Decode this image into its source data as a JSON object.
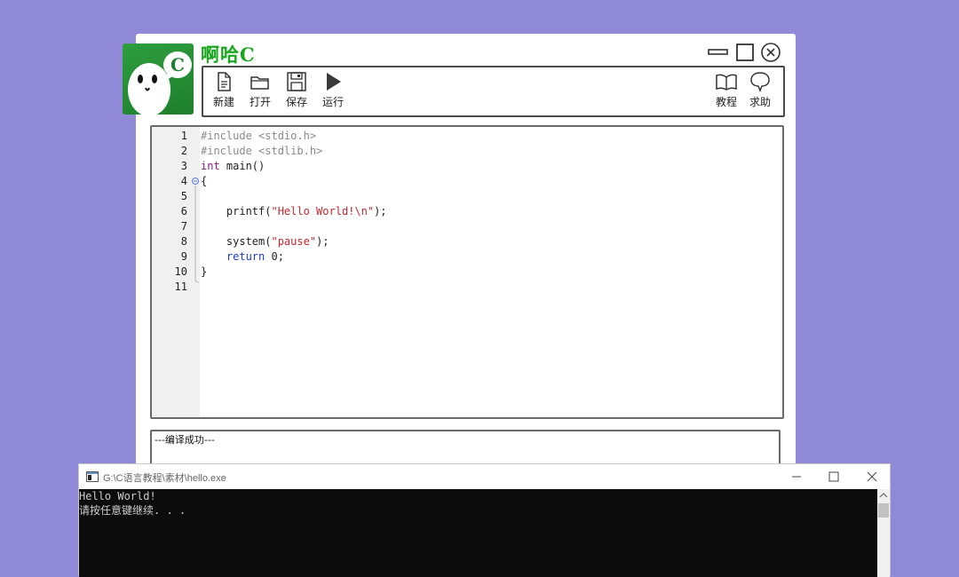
{
  "app": {
    "title": "啊哈C"
  },
  "toolbar": {
    "left": [
      {
        "label": "新建",
        "icon": "new-file-icon"
      },
      {
        "label": "打开",
        "icon": "open-folder-icon"
      },
      {
        "label": "保存",
        "icon": "save-disk-icon"
      },
      {
        "label": "运行",
        "icon": "run-play-icon"
      }
    ],
    "right": [
      {
        "label": "教程",
        "icon": "book-icon"
      },
      {
        "label": "求助",
        "icon": "speech-bubble-icon"
      }
    ]
  },
  "editor": {
    "lines": [
      {
        "num": "1",
        "text": "#include <stdio.h>"
      },
      {
        "num": "2",
        "text": "#include <stdlib.h>"
      },
      {
        "num": "3",
        "text": "int main()"
      },
      {
        "num": "4",
        "text": "{"
      },
      {
        "num": "5",
        "text": ""
      },
      {
        "num": "6",
        "text": "    printf(\"Hello World!\\n\");"
      },
      {
        "num": "7",
        "text": ""
      },
      {
        "num": "8",
        "text": "    system(\"pause\");"
      },
      {
        "num": "9",
        "text": "    return 0;"
      },
      {
        "num": "10",
        "text": "}"
      },
      {
        "num": "11",
        "text": ""
      }
    ]
  },
  "output": {
    "message": "---编译成功---"
  },
  "console": {
    "title": "G:\\C语言教程\\素材\\hello.exe",
    "lines": [
      "Hello World!",
      "请按任意键继续. . ."
    ]
  },
  "colors": {
    "background": "#9089d8",
    "brand_green": "#18a81f",
    "keyword_type": "#8b1a8b",
    "keyword": "#1a3cc8",
    "string": "#c0282c",
    "preprocessor": "#8a8a8a"
  }
}
